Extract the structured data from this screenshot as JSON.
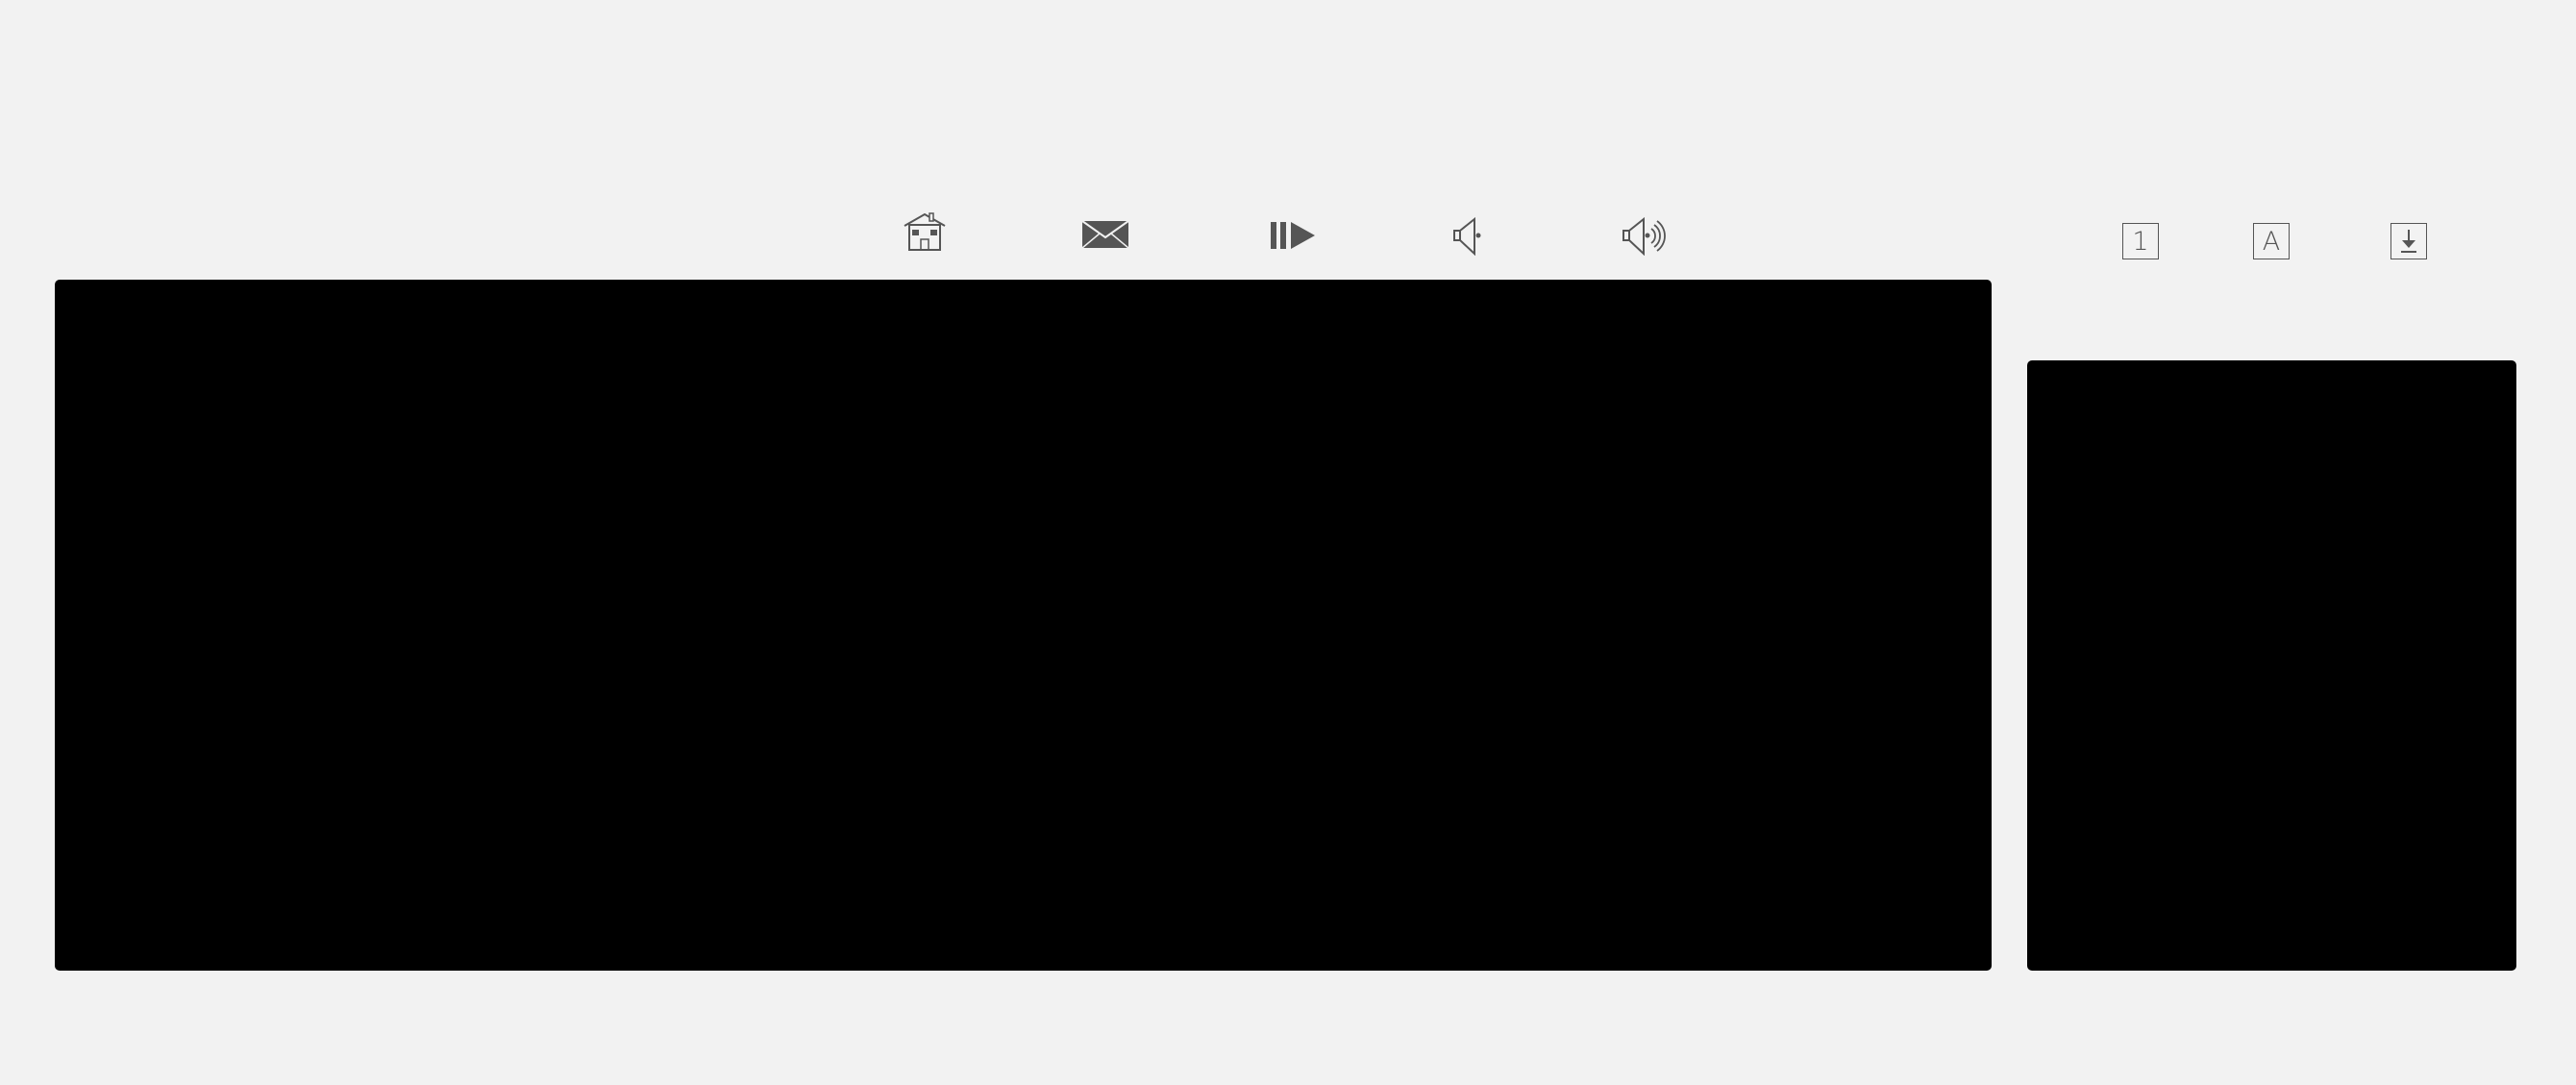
{
  "app": {
    "background": "#f2f2f2",
    "icon_color": "#555555",
    "panel_color": "#000000"
  },
  "toolbar": {
    "icons": [
      "home-icon",
      "mail-icon",
      "pause-play-icon",
      "speaker-muted-icon",
      "speaker-loud-icon"
    ]
  },
  "side_toolbar": {
    "number_label": "1",
    "font_label": "A",
    "icons": [
      "number-box-icon",
      "font-box-icon",
      "download-box-icon"
    ]
  },
  "panels": {
    "main": "main-display-panel",
    "side": "side-display-panel"
  }
}
